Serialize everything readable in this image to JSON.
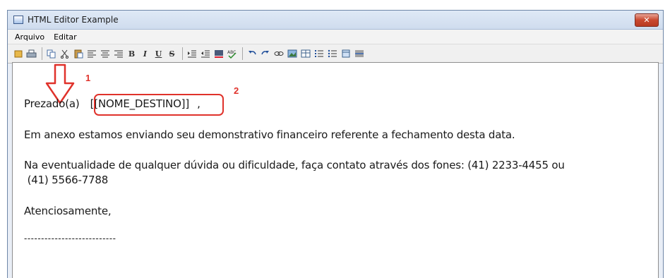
{
  "window": {
    "title": "HTML Editor Example",
    "close_label": "✕"
  },
  "menu": [
    "Arquivo",
    "Editar"
  ],
  "toolbar": {
    "group1": [
      "new-icon",
      "print-icon"
    ],
    "group2": [
      "copy-icon",
      "cut-icon",
      "paste-icon",
      "align-left-icon",
      "align-center-icon",
      "align-right-icon"
    ],
    "format": {
      "bold": "B",
      "italic": "I",
      "underline": "U",
      "strike": "S"
    },
    "group3": [
      "indent-icon",
      "outdent-icon",
      "font-color-icon",
      "spellcheck-icon"
    ],
    "group4": [
      "undo-icon",
      "redo-icon",
      "link-icon",
      "image-icon",
      "table-icon",
      "numbered-list-icon",
      "bullet-list-icon",
      "box-icon",
      "horizontal-rule-icon"
    ]
  },
  "annotations": {
    "one": "1",
    "two": "2"
  },
  "document": {
    "greeting_prefix": "Prezado(a)",
    "placeholder": "[[NOME_DESTINO]]",
    "greeting_suffix": ",",
    "paragraph1": "Em anexo estamos enviando seu demonstrativo financeiro referente a fechamento desta data.",
    "paragraph2_line1": "Na eventualidade de qualquer dúvida ou dificuldade, faça contato através dos fones: (41) 2233-4455  ou",
    "paragraph2_line2": " (41) 5566-7788",
    "closing": "Atenciosamente,",
    "divider": "---------------------------"
  }
}
